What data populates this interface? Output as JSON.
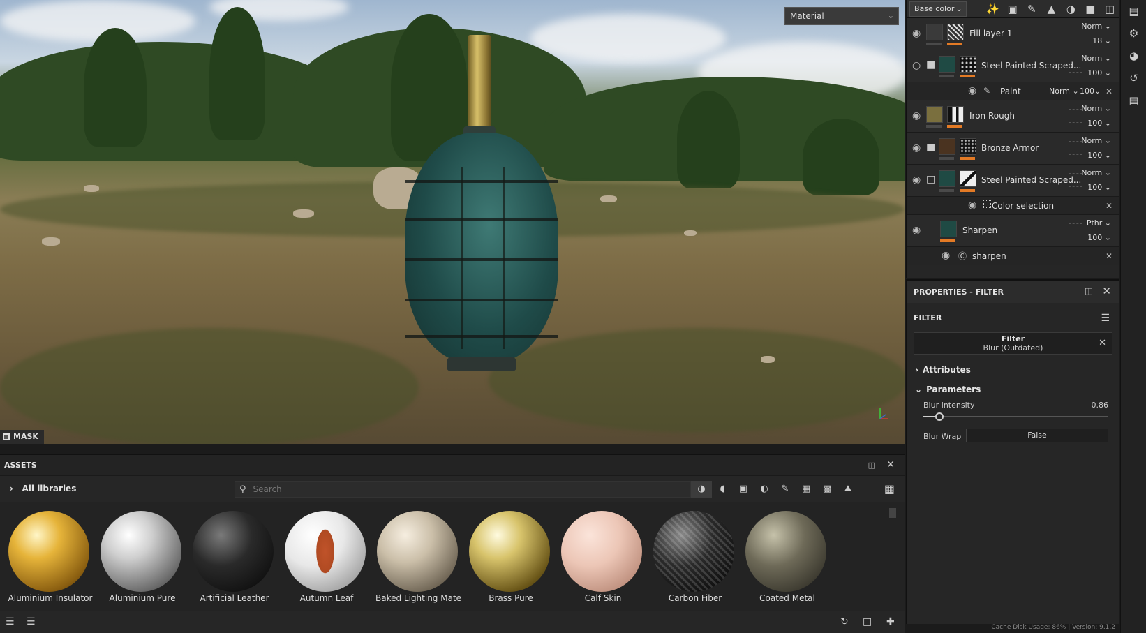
{
  "viewport": {
    "material_dropdown": "Material",
    "mask_label": "MASK"
  },
  "layers": {
    "channel_dropdown": "Base color",
    "toolbar_icons": [
      "magic-wand-icon",
      "fill-mask-icon",
      "brush-icon",
      "bucket-icon",
      "palette-icon",
      "folder-icon",
      "trash-icon"
    ],
    "rows": [
      {
        "name": "Fill layer 1",
        "blend": "Norm",
        "opacity": "18",
        "thumb": "#3a3a3a",
        "type": "layer"
      },
      {
        "name": "Steel Painted Scraped...",
        "blend": "Norm",
        "opacity": "100",
        "thumb": "#1f4a44",
        "type": "folder"
      },
      {
        "name": "Paint",
        "blend": "Norm",
        "opacity": "100",
        "type": "sub-paint"
      },
      {
        "name": "Iron Rough",
        "blend": "Norm",
        "opacity": "100",
        "thumb": "#7a6f3e",
        "type": "layer"
      },
      {
        "name": "Bronze Armor",
        "blend": "Norm",
        "opacity": "100",
        "thumb": "#4a3320",
        "type": "folder"
      },
      {
        "name": "Steel Painted Scraped...",
        "blend": "Norm",
        "opacity": "100",
        "thumb": "#1f4a44",
        "type": "folder-open"
      },
      {
        "name": "Color selection",
        "type": "sub-selection"
      },
      {
        "name": "Sharpen",
        "blend": "Pthr",
        "opacity": "100",
        "thumb": "#1f4a44",
        "type": "layer"
      },
      {
        "name": "sharpen",
        "type": "sub-filter"
      }
    ]
  },
  "properties": {
    "header": "PROPERTIES - FILTER",
    "filter_title": "FILTER",
    "filter_box_title": "Filter",
    "filter_box_value": "Blur (Outdated)",
    "attributes_label": "Attributes",
    "parameters_label": "Parameters",
    "blur_intensity_label": "Blur Intensity",
    "blur_intensity_value": "0.86",
    "blur_intensity_level": 0.086,
    "blur_wrap_label": "Blur Wrap",
    "blur_wrap_value": "False"
  },
  "assets": {
    "header": "ASSETS",
    "libraries_label": "All libraries",
    "search_placeholder": "Search",
    "items": [
      {
        "name": "Aluminium Insulator",
        "color_a": "#e6b43a",
        "color_b": "#6a4a10"
      },
      {
        "name": "Aluminium Pure",
        "color_a": "#f2f2f2",
        "color_b": "#555555"
      },
      {
        "name": "Artificial Leather",
        "color_a": "#5a5a5a",
        "color_b": "#111111"
      },
      {
        "name": "Autumn Leaf",
        "color_a": "#f4f4f4",
        "color_b": "#9a9a9a"
      },
      {
        "name": "Baked Lighting Mate...",
        "color_a": "#d8cdbb",
        "color_b": "#4a4238"
      },
      {
        "name": "Brass Pure",
        "color_a": "#f0e3a0",
        "color_b": "#4a3d10"
      },
      {
        "name": "Calf Skin",
        "color_a": "#f0d3c6",
        "color_b": "#a87866"
      },
      {
        "name": "Carbon Fiber",
        "color_a": "#6a6a6a",
        "color_b": "#0a0a0a"
      },
      {
        "name": "Coated Metal",
        "color_a": "#8a8670",
        "color_b": "#2a2820"
      }
    ]
  },
  "status_text": "Cache Disk Usage: 86% | Version: 9.1.2"
}
